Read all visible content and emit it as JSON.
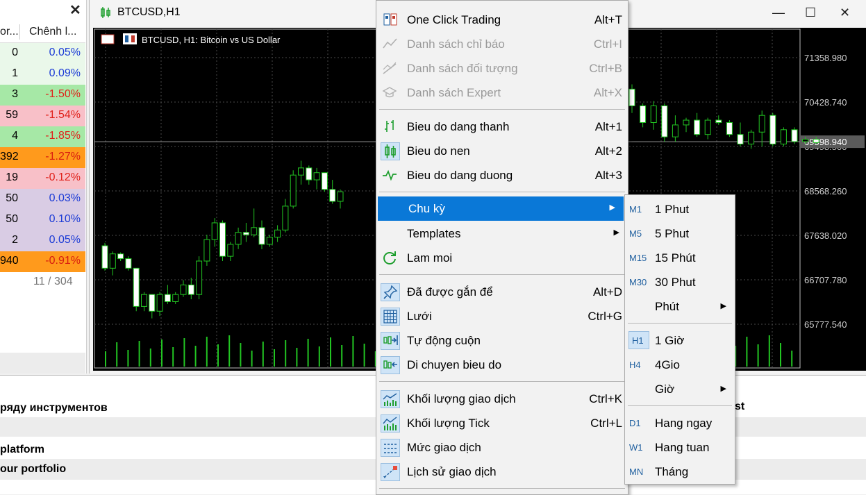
{
  "market_watch": {
    "close_symbol": "✕",
    "col1_header": "or...",
    "col2_header": "Chênh l...",
    "rows": [
      {
        "c1": "0",
        "c2": "0.05%",
        "bg": "#eaf8ea",
        "color": "#1a3ad6"
      },
      {
        "c1": "1",
        "c2": "0.09%",
        "bg": "#eaf8ea",
        "color": "#1a3ad6"
      },
      {
        "c1": "3",
        "c2": "-1.50%",
        "bg": "#a6e8a6",
        "color": "#e0201a"
      },
      {
        "c1": "59",
        "c2": "-1.54%",
        "bg": "#f8c0c8",
        "color": "#e0201a"
      },
      {
        "c1": "4",
        "c2": "-1.85%",
        "bg": "#a6e8a6",
        "color": "#e0201a"
      },
      {
        "c1": "392",
        "c2": "-1.27%",
        "bg": "#ff9a1c",
        "color": "#d81c10"
      },
      {
        "c1": "19",
        "c2": "-0.12%",
        "bg": "#f8c0c8",
        "color": "#e0201a"
      },
      {
        "c1": "50",
        "c2": "0.03%",
        "bg": "#d9cce4",
        "color": "#1a3ad6"
      },
      {
        "c1": "50",
        "c2": "0.10%",
        "bg": "#d9cce4",
        "color": "#1a3ad6"
      },
      {
        "c1": "2",
        "c2": "0.05%",
        "bg": "#d9cce4",
        "color": "#1a3ad6"
      },
      {
        "c1": "940",
        "c2": "-0.91%",
        "bg": "#ff9a1c",
        "color": "#d81c10"
      }
    ],
    "count": "11 / 304"
  },
  "chart_window": {
    "title": "BTCUSD,H1",
    "info": "BTCUSD, H1:  Bitcoin vs US Dollar",
    "minimize": "—",
    "maximize": "☐",
    "close": "✕",
    "price_labels": [
      "71358.980",
      "70428.740",
      "69598.940",
      "69498.500",
      "68568.260",
      "67638.020",
      "66707.780",
      "65777.540"
    ],
    "current_price": "69598.940",
    "colors": {
      "up": "#22c522",
      "down_fill": "#ffffff",
      "volume": "#22c522",
      "grid": "#4a4a4a"
    }
  },
  "chart_data": {
    "type": "candlestick",
    "symbol": "BTCUSD",
    "timeframe": "H1",
    "y_ticks": [
      71358.98,
      70428.74,
      69498.5,
      68568.26,
      67638.02,
      66707.78,
      65777.54
    ],
    "current_price": 69598.94,
    "candles_left": [
      [
        67420,
        67480,
        66900,
        66950
      ],
      [
        66950,
        67300,
        66800,
        67250
      ],
      [
        67250,
        67280,
        67100,
        67150
      ],
      [
        67150,
        67200,
        66900,
        66950
      ],
      [
        66950,
        66950,
        66050,
        66150
      ],
      [
        66150,
        66450,
        66050,
        66400
      ],
      [
        66400,
        66400,
        65900,
        66050
      ],
      [
        66050,
        66450,
        65950,
        66400
      ],
      [
        66400,
        66600,
        66200,
        66250
      ],
      [
        66250,
        66450,
        66200,
        66400
      ],
      [
        66400,
        66700,
        66350,
        66600
      ],
      [
        66600,
        66750,
        66300,
        66400
      ],
      [
        66400,
        67200,
        66300,
        67100
      ],
      [
        67100,
        67650,
        67000,
        67550
      ],
      [
        67550,
        68000,
        67400,
        67900
      ],
      [
        67900,
        67950,
        67100,
        67200
      ],
      [
        67200,
        67500,
        67100,
        67450
      ],
      [
        67450,
        67800,
        67350,
        67700
      ],
      [
        67700,
        67900,
        67500,
        67650
      ],
      [
        67650,
        68200,
        67600,
        67800
      ],
      [
        67800,
        67950,
        67350,
        67450
      ],
      [
        67450,
        67650,
        67400,
        67600
      ],
      [
        67600,
        67850,
        67500,
        67750
      ],
      [
        67750,
        68400,
        67700,
        68250
      ],
      [
        68250,
        69000,
        68200,
        68900
      ],
      [
        68900,
        69200,
        68700,
        69050
      ],
      [
        69050,
        69100,
        68700,
        68800
      ],
      [
        68800,
        69050,
        68600,
        68950
      ],
      [
        68950,
        68950,
        68550,
        68600
      ],
      [
        68600,
        68800,
        68300,
        68350
      ],
      [
        68350,
        68600,
        68200,
        68550
      ]
    ],
    "candles_right": [
      [
        70700,
        70800,
        70200,
        70350
      ],
      [
        70350,
        70400,
        69900,
        70000
      ],
      [
        70000,
        70450,
        69850,
        70350
      ],
      [
        70350,
        70400,
        69600,
        69700
      ],
      [
        69700,
        70150,
        69600,
        69950
      ],
      [
        69950,
        70100,
        69800,
        70050
      ],
      [
        70050,
        70200,
        69700,
        69750
      ],
      [
        69750,
        70100,
        69650,
        70050
      ],
      [
        70050,
        70150,
        69950,
        70000
      ],
      [
        70000,
        70050,
        69700,
        69750
      ],
      [
        69750,
        70000,
        69500,
        69550
      ],
      [
        69550,
        69850,
        69450,
        69800
      ],
      [
        69800,
        70250,
        69500,
        70150
      ],
      [
        70150,
        70200,
        69500,
        69550
      ],
      [
        69550,
        69900,
        69500,
        69850
      ],
      [
        69850,
        69900,
        69550,
        69600
      ],
      [
        69600,
        69700,
        69550,
        69650
      ],
      [
        69650,
        69700,
        69550,
        69580
      ]
    ]
  },
  "context_menu": {
    "items": [
      {
        "label": "One Click Trading",
        "shortcut": "Alt+T",
        "icon": "one-click-trading-icon",
        "disabled": false
      },
      {
        "label": "Danh sách chỉ báo",
        "shortcut": "Ctrl+I",
        "icon": "indicator-list-icon",
        "disabled": true
      },
      {
        "label": "Danh sách đối tượng",
        "shortcut": "Ctrl+B",
        "icon": "object-list-icon",
        "disabled": true
      },
      {
        "label": "Danh sách Expert",
        "shortcut": "Alt+X",
        "icon": "expert-list-icon",
        "disabled": true
      },
      {
        "label": "Bieu do dang thanh",
        "shortcut": "Alt+1",
        "icon": "bar-chart-icon",
        "disabled": false
      },
      {
        "label": "Bieu do nen",
        "shortcut": "Alt+2",
        "icon": "candlestick-icon",
        "disabled": false
      },
      {
        "label": "Bieu do dang duong",
        "shortcut": "Alt+3",
        "icon": "line-chart-icon",
        "disabled": false
      },
      {
        "label": "Chu kỳ",
        "shortcut": "",
        "icon": "",
        "disabled": false
      },
      {
        "label": "Templates",
        "shortcut": "",
        "icon": "",
        "disabled": false
      },
      {
        "label": "Lam moi",
        "shortcut": "",
        "icon": "refresh-icon",
        "disabled": false
      },
      {
        "label": "Đã được gắn để",
        "shortcut": "Alt+D",
        "icon": "pin-icon",
        "disabled": false
      },
      {
        "label": "Lưới",
        "shortcut": "Ctrl+G",
        "icon": "grid-icon",
        "disabled": false
      },
      {
        "label": "Tự động cuộn",
        "shortcut": "",
        "icon": "autoscroll-icon",
        "disabled": false
      },
      {
        "label": "Di chuyen bieu do",
        "shortcut": "",
        "icon": "chart-shift-icon",
        "disabled": false
      },
      {
        "label": "Khối lượng giao dịch",
        "shortcut": "Ctrl+K",
        "icon": "volume-icon",
        "disabled": false
      },
      {
        "label": "Khối lượng Tick",
        "shortcut": "Ctrl+L",
        "icon": "tick-volume-icon",
        "disabled": false
      },
      {
        "label": "Mức giao dịch",
        "shortcut": "",
        "icon": "trade-levels-icon",
        "disabled": false
      },
      {
        "label": "Lịch sử giao dịch",
        "shortcut": "",
        "icon": "trade-history-icon",
        "disabled": false
      }
    ]
  },
  "submenu": {
    "items": [
      {
        "tag": "M1",
        "label": "1 Phut"
      },
      {
        "tag": "M5",
        "label": "5 Phut"
      },
      {
        "tag": "M15",
        "label": "15 Phút"
      },
      {
        "tag": "M30",
        "label": "30 Phut"
      },
      {
        "tag": "",
        "label": "Phút"
      },
      {
        "tag": "H1",
        "label": "1 Giờ"
      },
      {
        "tag": "H4",
        "label": "4Gio"
      },
      {
        "tag": "",
        "label": "Giờ"
      },
      {
        "tag": "D1",
        "label": "Hang ngay"
      },
      {
        "tag": "W1",
        "label": "Hang tuan"
      },
      {
        "tag": "MN",
        "label": "Tháng"
      }
    ]
  },
  "bottom_panel": {
    "rows": [
      "ряду инструментов",
      "platform",
      "our portfolio"
    ],
    "right_fragment": "st"
  }
}
